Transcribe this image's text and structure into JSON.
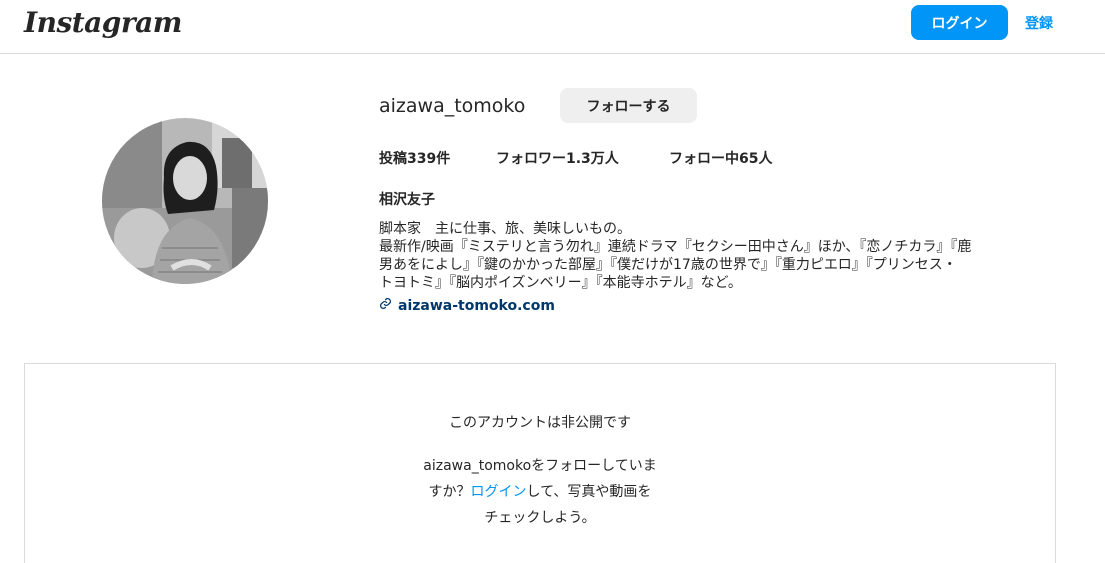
{
  "header": {
    "logo": "Instagram",
    "login_label": "ログイン",
    "signup_label": "登録"
  },
  "profile": {
    "username": "aizawa_tomoko",
    "follow_label": "フォローする",
    "stats": {
      "posts_label": "投稿",
      "posts_value": "339件",
      "followers_label": "フォロワー",
      "followers_value": "1.3万人",
      "following_label": "フォロー中",
      "following_value": "65人"
    },
    "full_name": "相沢友子",
    "bio_lines": [
      "脚本家　主に仕事、旅、美味しいもの。",
      "最新作/映画『ミステリと言う勿れ』連続ドラマ『セクシー田中さん』ほか、『恋ノチカラ』『鹿",
      "男あをによし』『鍵のかかった部屋』『僕だけが17歳の世界で』『重力ピエロ』『プリンセス・",
      "トヨトミ』『脳内ポイズンベリー』『本能寺ホテル』など。"
    ],
    "website": "aizawa-tomoko.com"
  },
  "private": {
    "title": "このアカウントは非公開です",
    "line1": "aizawa_tomokoをフォローしていま",
    "line2_before": "すか？",
    "line2_link": "ログイン",
    "line2_after": "して、写真や動画を",
    "line3": "チェックしよう。"
  },
  "colors": {
    "accent": "#0095f6",
    "link_dark": "#00376b",
    "border": "#dbdbdb",
    "button_gray": "#efefef"
  }
}
